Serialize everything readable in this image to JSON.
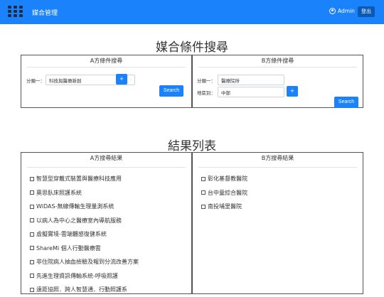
{
  "header": {
    "app_title": "媒合管理",
    "user_name": "Admin",
    "logout_label": "登出"
  },
  "search_section": {
    "heading": "媒合條件搜尋",
    "panel_a": {
      "title": "A方條件搜尋",
      "category_label": "分類一：",
      "category_value": "科技與醫療新創",
      "add_label": "+",
      "search_label": "Search"
    },
    "panel_b": {
      "title": "B方條件搜尋",
      "category_label": "分類一：",
      "category_value": "醫療院所",
      "region_label": "地區別：",
      "region_value": "中部",
      "add_label": "+",
      "search_label": "Search"
    }
  },
  "results_section": {
    "heading": "結果列表",
    "panel_a": {
      "title": "A方搜尋結果",
      "items": [
        "智慧型穿戴式裝置與醫療科技應用",
        "奧思臥床照護系統",
        "WiDAS-無線傳輸生理量測系統",
        "以病人為中心之醫療室內導航服務",
        "虛擬實境-雲端體感復健系統",
        "ShareMi 個人行動醫療雲",
        "非住院病人抽血檢驗及報到分流改善方案",
        "先進生理資訊傳輸系統-呼吸照護",
        "遠距協照．跨人智慧通．行動照護系"
      ]
    },
    "panel_b": {
      "title": "B方搜尋結果",
      "items": [
        "彰化基督教醫院",
        "台中童綜合醫院",
        "南投埔里醫院"
      ]
    }
  }
}
